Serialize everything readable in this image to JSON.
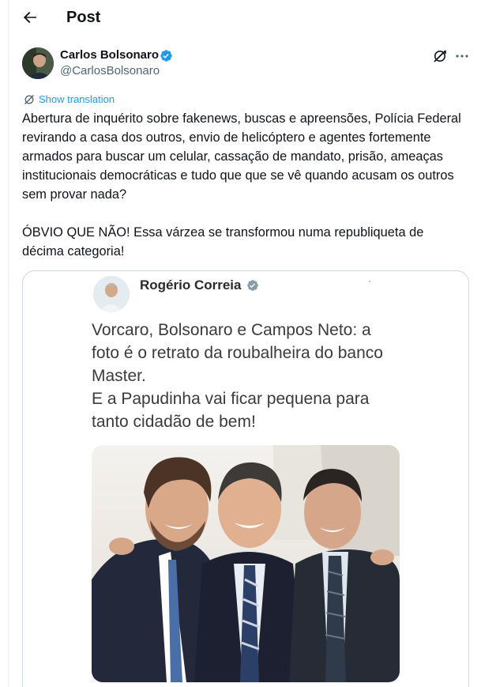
{
  "header": {
    "title": "Post",
    "back_icon": "arrow-left-icon"
  },
  "post": {
    "author": {
      "name": "Carlos Bolsonaro",
      "handle": "@CarlosBolsonaro",
      "verified": true
    },
    "translate_label": "Show translation",
    "paragraphs": [
      "Abertura de inquérito sobre fakenews, buscas e apreensões, Polícia Federal revirando a casa dos outros, envio de helicóptero e agentes fortemente armados para buscar um celular, cassação de mandato, prisão, ameaças institucionais democráticas e tudo que que se vê quando acusam os outros sem provar nada?",
      "ÓBVIO QUE NÃO! Essa várzea se transformou numa republiqueta de décima categoria!"
    ]
  },
  "embedded": {
    "name": "Rogério Correia",
    "text": "Vorcaro, Bolsonaro e Campos Neto: a\nfoto é o retrato da roubalheira do banco\nMaster.\nE a Papudinha vai ficar pequena para\ntanto cidadão de bem!"
  },
  "colors": {
    "accent": "#1d9bf0",
    "text": "#0f1419",
    "muted": "#536471",
    "border": "#cfd9de"
  }
}
